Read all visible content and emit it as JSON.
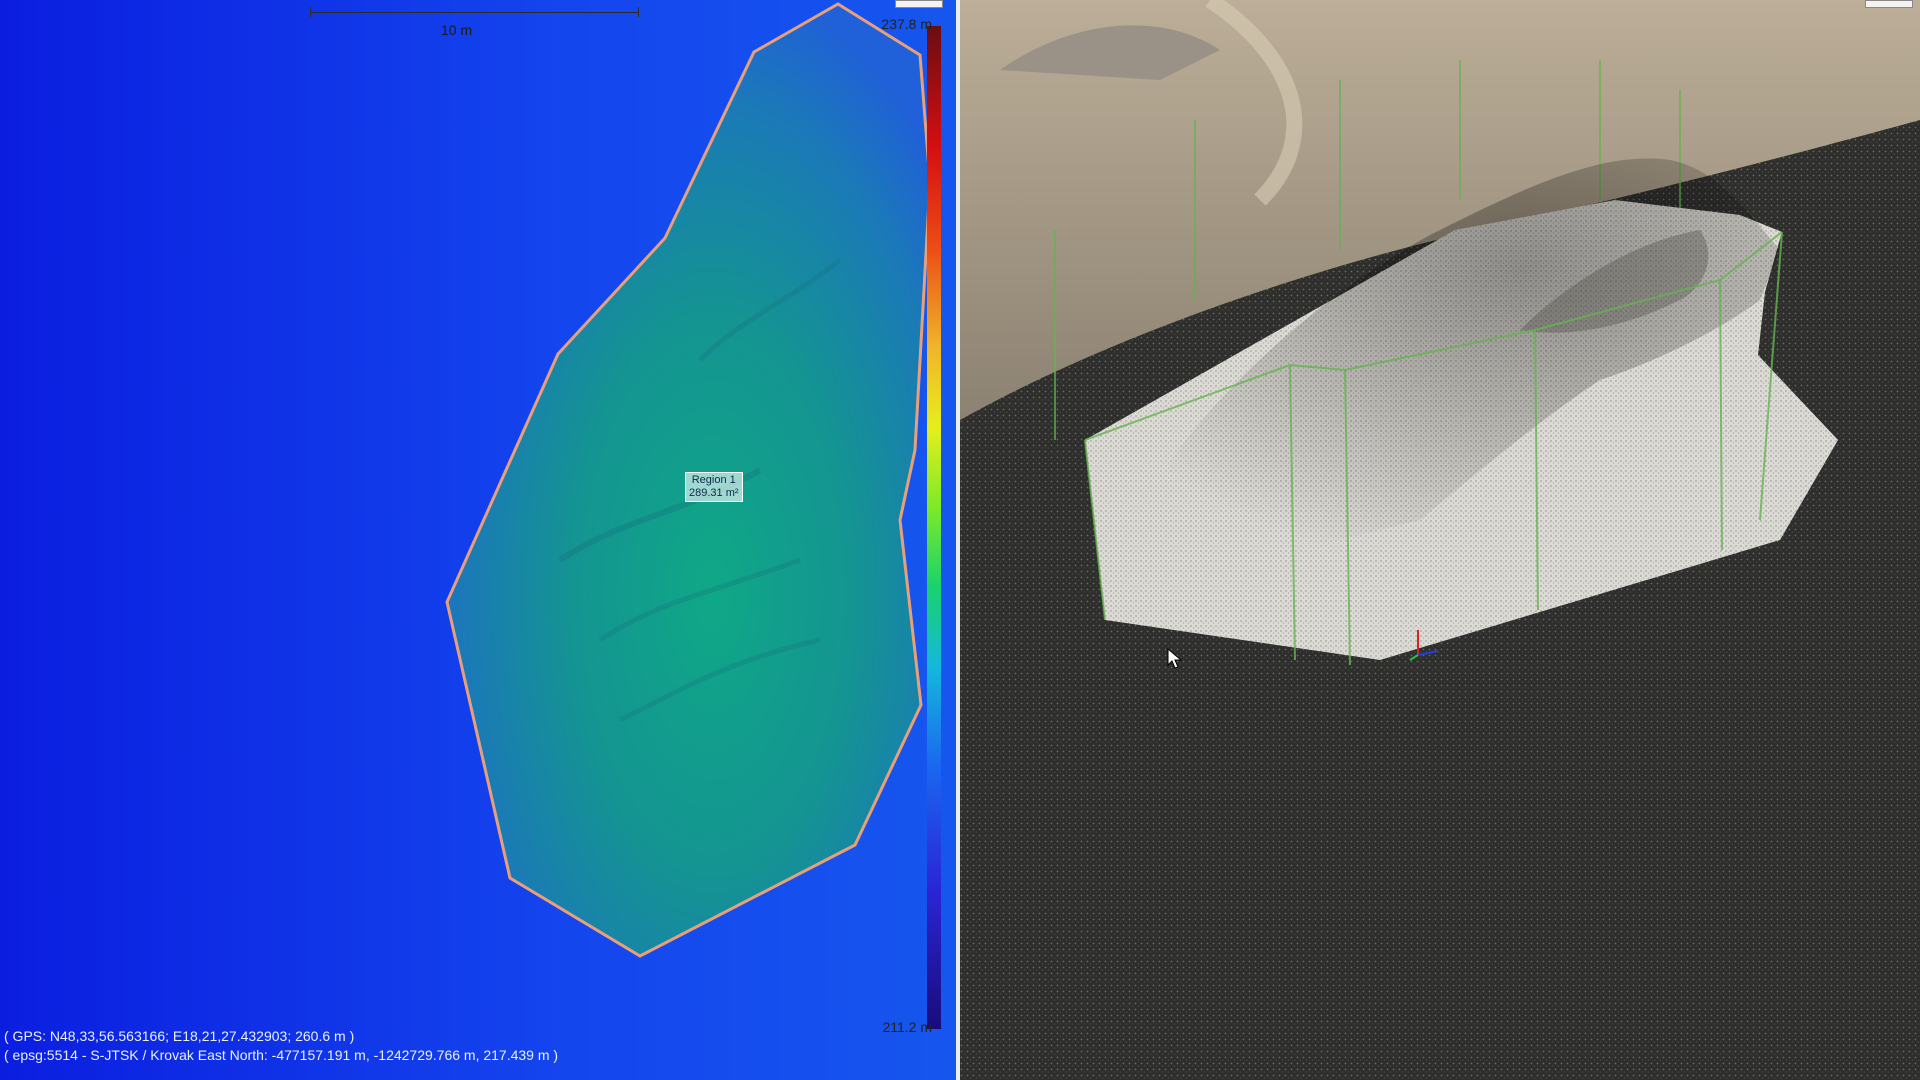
{
  "left_view": {
    "scale_bar_label": "10 m",
    "legend_max": "237.8 m",
    "legend_min": "211.2 m",
    "region_name": "Region 1",
    "region_area": "289.31 m²",
    "gps_line": "( GPS: N48,33,56.563166; E18,21,27.432903; 260.6 m )",
    "epsg_line": "( epsg:5514 - S-JTSK / Krovak East North: -477157.191 m, -1242729.766 m, 217.439 m )",
    "colors": {
      "background": "#1040ee",
      "region_outline": "#e7a07a",
      "region_fill": "#1a9c8a"
    }
  },
  "right_view": {
    "icons": [
      "mouse-cursor-icon",
      "axis-gizmo-icon"
    ],
    "colors": {
      "ground": "#2c2c2a",
      "pile": "#d8d6d0",
      "fence": "#64b450"
    }
  }
}
